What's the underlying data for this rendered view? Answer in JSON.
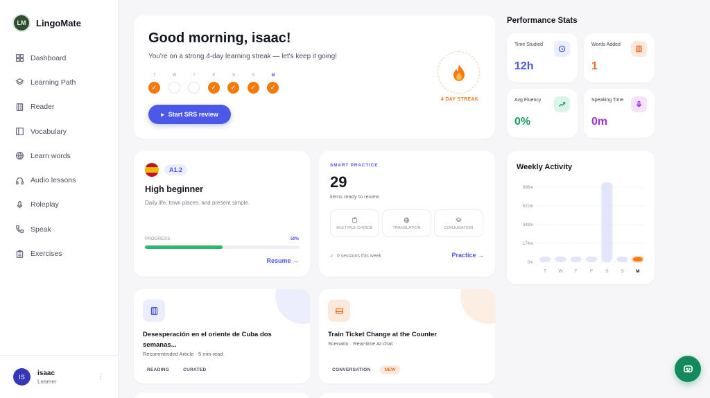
{
  "brand": {
    "name": "LingoMate",
    "logo_text": "LM"
  },
  "nav": [
    {
      "label": "Dashboard",
      "icon": "dashboard-icon"
    },
    {
      "label": "Learning Path",
      "icon": "layers-icon"
    },
    {
      "label": "Reader",
      "icon": "book-icon"
    },
    {
      "label": "Vocabulary",
      "icon": "vocabulary-icon"
    },
    {
      "label": "Learn words",
      "icon": "globe-icon"
    },
    {
      "label": "Audio lessons",
      "icon": "headphones-icon"
    },
    {
      "label": "Roleplay",
      "icon": "microphone-icon"
    },
    {
      "label": "Speak",
      "icon": "phone-icon"
    },
    {
      "label": "Exercises",
      "icon": "clipboard-icon"
    }
  ],
  "user": {
    "initials": "IS",
    "name": "isaac",
    "role": "Learner",
    "menu": "⋮"
  },
  "greeting": {
    "title": "Good morning, isaac!",
    "subtitle": "You're on a strong 4-day learning streak — let's keep it going!",
    "days": [
      {
        "label": "T",
        "done": true,
        "today": false
      },
      {
        "label": "W",
        "done": false,
        "today": false
      },
      {
        "label": "T",
        "done": false,
        "today": false
      },
      {
        "label": "F",
        "done": true,
        "today": false
      },
      {
        "label": "S",
        "done": true,
        "today": false
      },
      {
        "label": "S",
        "done": true,
        "today": false
      },
      {
        "label": "M",
        "done": true,
        "today": true
      }
    ],
    "check_glyph": "✓",
    "button_icon": "▸",
    "button_label": "Start SRS review",
    "streak_label": "4 DAY STREAK"
  },
  "level": {
    "code": "A1.2",
    "title": "High beginner",
    "description": "Daily life, town places, and present simple.",
    "progress_label": "PROGRESS",
    "progress_value": "50%",
    "progress": 0.5,
    "resume_label": "Resume →"
  },
  "smart": {
    "tag": "SMART PRACTICE",
    "count": "29",
    "subtitle": "items ready to review",
    "modes": [
      {
        "label": "MULTIPLE CHOICE",
        "icon": "clipboard-icon"
      },
      {
        "label": "TRANSLATION",
        "icon": "globe-icon"
      },
      {
        "label": "CONJUGATION",
        "icon": "layers-icon"
      }
    ],
    "sessions_check": "✓",
    "sessions": "0 sessions this week",
    "practice_label": "Practice →"
  },
  "article": {
    "title": "Desesperación en el oriente de Cuba dos semanas...",
    "meta": "Recommended Article · 5 min read",
    "chips": [
      "READING",
      "CURATED"
    ]
  },
  "scenario": {
    "title": "Train Ticket Change at the Counter",
    "meta": "Scenario · Real-time AI chat",
    "chip": "CONVERSATION",
    "badge": "NEW"
  },
  "stats": {
    "title": "Performance Stats",
    "items": [
      {
        "label": "Time Studied",
        "value": "12h",
        "color": "#4b55e6",
        "icon": "clock-icon"
      },
      {
        "label": "Words Added",
        "value": "1",
        "color": "#ee6a1e",
        "icon": "book-icon"
      },
      {
        "label": "Avg Fluency",
        "value": "0%",
        "color": "#1a9b62",
        "icon": "trend-up-icon"
      },
      {
        "label": "Speaking Time",
        "value": "0m",
        "color": "#9b2fe0",
        "icon": "microphone-icon"
      }
    ]
  },
  "chart_data": {
    "type": "bar",
    "title": "Weekly Activity",
    "categories": [
      "T",
      "W",
      "T",
      "F",
      "S",
      "S",
      "M"
    ],
    "values": [
      0,
      0,
      0,
      0,
      870,
      0,
      0
    ],
    "highlight_index": 6,
    "yticks": [
      "0m",
      "174m",
      "348m",
      "522m",
      "696m"
    ],
    "ylim": [
      0,
      870
    ],
    "grid": true,
    "colors": {
      "bar": "#e3e5fb",
      "highlight": "#f47a0c"
    }
  }
}
